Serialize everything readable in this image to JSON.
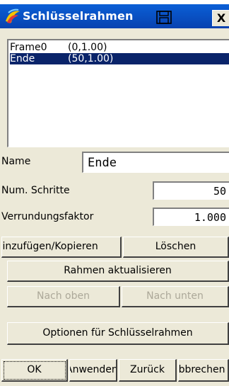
{
  "window": {
    "title": "Schlüsselrahmen",
    "close_glyph": "X",
    "icon": "app-icon",
    "title_button_icon": "save-icon"
  },
  "keyframes": [
    {
      "name": "Frame0",
      "value": "(0,1.00)"
    },
    {
      "name": "Ende",
      "value": "(50,1.00)"
    }
  ],
  "selected_index": 1,
  "form": {
    "name_label": "Name",
    "name_value": "Ende",
    "steps_label": "Num. Schritte",
    "steps_value": "50",
    "rounding_label": "Verrundungsfaktor",
    "rounding_value": "1.000"
  },
  "buttons": {
    "add_copy": "Hinzufügen/Kopieren",
    "delete": "Löschen",
    "update": "Rahmen aktualisieren",
    "move_up": "Nach oben",
    "move_down": "Nach unten",
    "options": "Optionen für Schlüsselrahmen",
    "ok": "OK",
    "apply": "Anwenden",
    "back": "Zurück",
    "cancel": "Abbrechen"
  },
  "colors": {
    "titlebar": "#0a5fd6",
    "selection": "#0a246a",
    "dialog_bg": "#ece9d8",
    "disabled_text": "#aca899"
  }
}
